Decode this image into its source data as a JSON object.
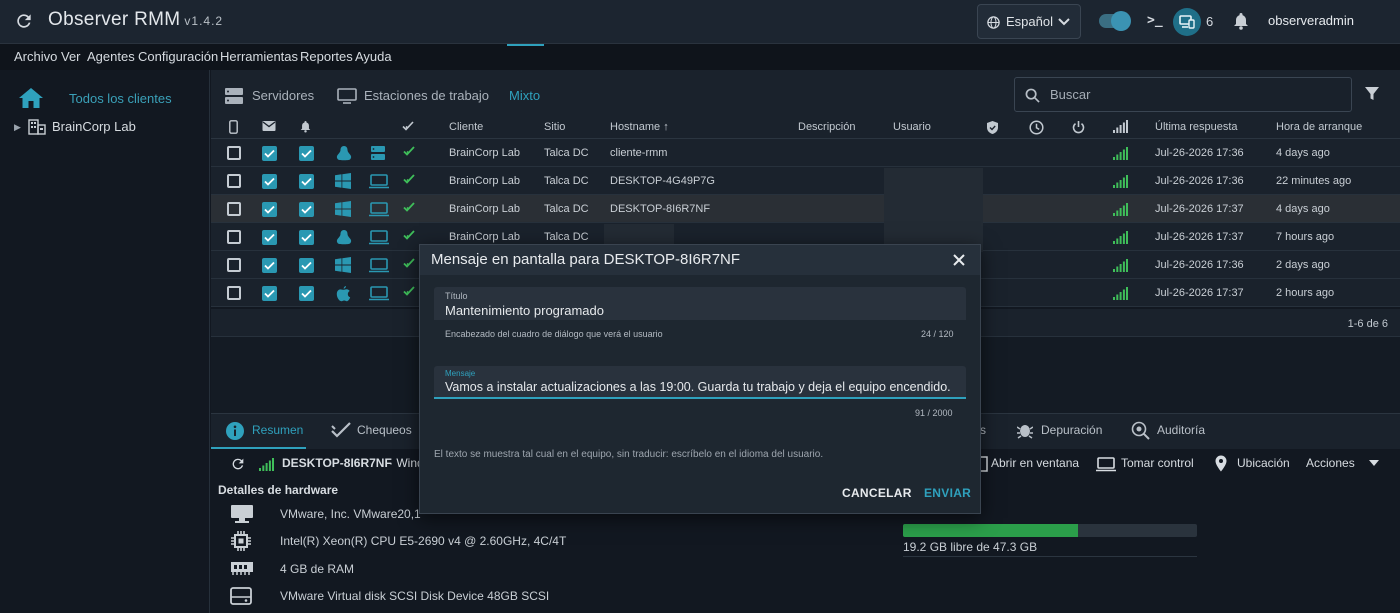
{
  "app": {
    "name": "Observer RMM",
    "version": "v1.4.2",
    "username": "observeradmin",
    "agent_count": "6",
    "terminal_label": ">_",
    "language": "Español"
  },
  "menu": [
    "Archivo",
    "Ver",
    "Agentes",
    "Configuración",
    "Herramientas",
    "Reportes",
    "Ayuda"
  ],
  "sidebar": {
    "all_clients": "Todos los clientes",
    "tree": [
      {
        "label": "BrainCorp Lab"
      }
    ]
  },
  "tabs": [
    "Servidores",
    "Estaciones de trabajo",
    "Mixto"
  ],
  "active_tab": "Mixto",
  "search": {
    "placeholder": "Buscar"
  },
  "table": {
    "columns": {
      "client": "Cliente",
      "site": "Sitio",
      "hostname": "Hostname",
      "description": "Descripción",
      "user": "Usuario",
      "last_response": "Última respuesta",
      "boot_time": "Hora de arranque"
    },
    "sort_indicator": "↑",
    "rows": [
      {
        "client": "BrainCorp Lab",
        "site": "Talca DC",
        "hostname": "cliente-rmm",
        "last_response": "Jul-26-2026 17:36",
        "boot_time": "4 days ago",
        "os": "linux",
        "type": "server"
      },
      {
        "client": "BrainCorp Lab",
        "site": "Talca DC",
        "hostname": "DESKTOP-4G49P7G",
        "last_response": "Jul-26-2026 17:36",
        "boot_time": "22 minutes ago",
        "os": "windows",
        "type": "workstation"
      },
      {
        "client": "BrainCorp Lab",
        "site": "Talca DC",
        "hostname": "DESKTOP-8I6R7NF",
        "last_response": "Jul-26-2026 17:37",
        "boot_time": "4 days ago",
        "os": "windows",
        "type": "workstation"
      },
      {
        "client": "BrainCorp Lab",
        "site": "Talca DC",
        "hostname": "",
        "last_response": "Jul-26-2026 17:37",
        "boot_time": "7 hours ago",
        "os": "linux",
        "type": "workstation"
      },
      {
        "client": "",
        "site": "",
        "hostname": "",
        "last_response": "Jul-26-2026 17:36",
        "boot_time": "2 days ago",
        "os": "windows",
        "type": "workstation"
      },
      {
        "client": "",
        "site": "",
        "hostname": "",
        "last_response": "Jul-26-2026 17:37",
        "boot_time": "2 hours ago",
        "os": "apple",
        "type": "workstation"
      }
    ],
    "pagination": "1-6 de 6"
  },
  "bottom": {
    "tabs": [
      "Resumen",
      "Chequeos",
      "s",
      "Depuración",
      "Auditoría"
    ],
    "active_tab": "Resumen",
    "agent_header": "DESKTOP-8I6R7NF",
    "agent_suffix": "· Wind",
    "actions": [
      "Abrir en ventana",
      "Tomar control",
      "Ubicación",
      "Acciones"
    ],
    "hardware_title": "Detalles de hardware",
    "hardware": [
      "VMware, Inc. VMware20,1",
      "Intel(R) Xeon(R) CPU E5-2690 v4 @ 2.60GHz, 4C/4T",
      "4 GB de RAM",
      "VMware Virtual disk SCSI Disk Device 48GB SCSI"
    ],
    "disk": {
      "free_text": "19.2 GB libre de 47.3 GB",
      "used_fraction": 0.594
    }
  },
  "dialog": {
    "title": "Mensaje en pantalla para DESKTOP-8I6R7NF",
    "title_field": {
      "label": "Título",
      "value": "Mantenimiento programado",
      "hint": "Encabezado del cuadro de diálogo que verá el usuario",
      "counter": "24 / 120"
    },
    "message_field": {
      "label": "Mensaje",
      "value": "Vamos a instalar actualizaciones a las 19:00. Guarda tu trabajo y deja el equipo encendido.",
      "counter": "91 / 2000"
    },
    "note": "El texto se muestra tal cual en el equipo, sin traducir: escríbelo en el idioma del usuario.",
    "cancel": "CANCELAR",
    "send": "ENVIAR"
  },
  "colors": {
    "accent": "#2fa1bd",
    "checkbox": "#2a98b2",
    "success": "#3fbf5a",
    "background": "#121821"
  }
}
